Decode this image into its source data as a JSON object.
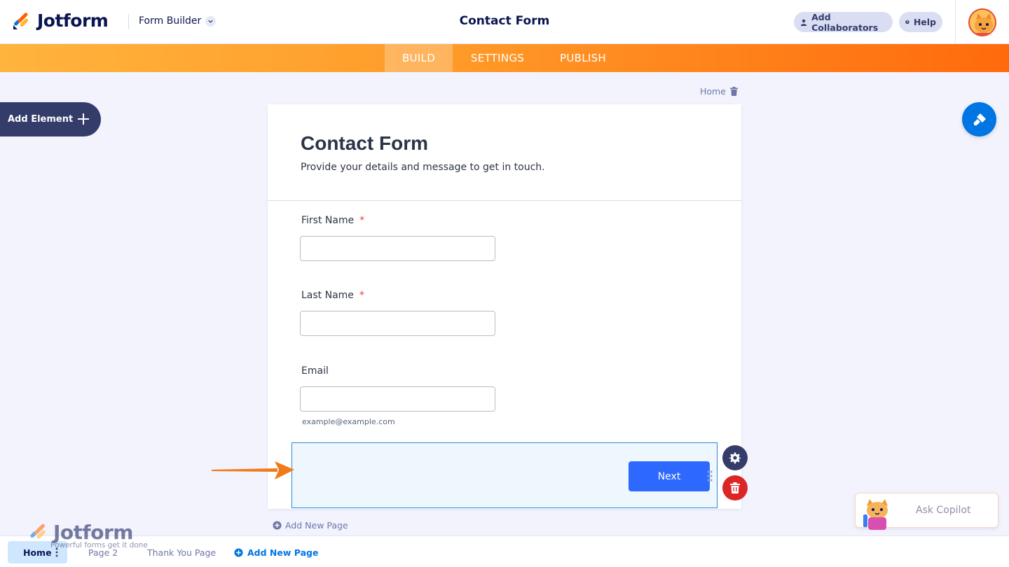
{
  "header": {
    "logo_text": "Jotform",
    "builder_label": "Form Builder",
    "title": "Contact Form",
    "collaborators_label": "Add Collaborators",
    "help_label": "Help"
  },
  "nav": {
    "tabs": [
      {
        "label": "BUILD",
        "active": true
      },
      {
        "label": "SETTINGS",
        "active": false
      },
      {
        "label": "PUBLISH",
        "active": false
      }
    ]
  },
  "sidebar": {
    "add_element_label": "Add Element"
  },
  "page_label": "Home",
  "form": {
    "title": "Contact Form",
    "subtitle": "Provide your details and message to get in touch.",
    "fields": [
      {
        "label": "First Name",
        "required_mark": "*",
        "value": ""
      },
      {
        "label": "Last Name",
        "required_mark": "*",
        "value": ""
      },
      {
        "label": "Email",
        "required_mark": "",
        "value": "",
        "sublabel": "example@example.com"
      }
    ],
    "next_label": "Next"
  },
  "add_new_page_inline": "Add New Page",
  "copilot": {
    "label": "Ask Copilot"
  },
  "bottom_tabs": {
    "home": "Home",
    "page2": "Page 2",
    "thank_you": "Thank You Page",
    "add_new": "Add New Page"
  },
  "watermark": {
    "text": "Jotform",
    "tagline": "Powerful forms get it done"
  },
  "colors": {
    "accent_blue": "#0075e3",
    "button_blue": "#2e69ff",
    "orange": "#ff6a0d",
    "navy": "#0a1551",
    "danger": "#dc2626"
  }
}
